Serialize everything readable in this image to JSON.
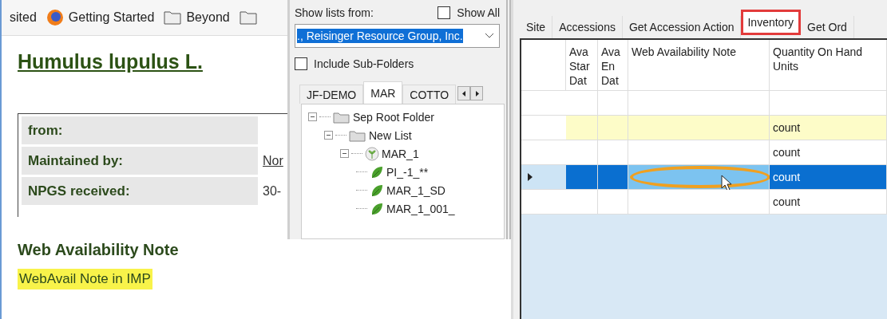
{
  "browser": {
    "bookmarks": [
      {
        "kind": "text",
        "label": "sited"
      },
      {
        "kind": "firefox",
        "label": "Getting Started"
      },
      {
        "kind": "folder",
        "label": "Beyond"
      },
      {
        "kind": "folder"
      }
    ],
    "title": "Humulus lupulus L.",
    "details": [
      {
        "label": "from:"
      },
      {
        "label": "Maintained by:",
        "value": "Nor",
        "kind": "link"
      },
      {
        "label": "NPGS received:",
        "value": "30-",
        "kind": "text"
      }
    ],
    "note_heading": "Web Availability Note",
    "note_text": "WebAvail Note in IMP"
  },
  "lists_panel": {
    "show_lists_label": "Show lists from:",
    "show_all": {
      "label": "Show All",
      "checked": false
    },
    "owner": "., Reisinger Resource Group, Inc.",
    "include_subfolders": {
      "label": "Include Sub-Folders",
      "checked": false
    },
    "tabs": [
      {
        "label": "JF-DEMO",
        "selected": false
      },
      {
        "label": "MAR",
        "selected": true
      },
      {
        "label": "COTTO",
        "selected": false
      }
    ],
    "tree": [
      {
        "label": "Sep Root Folder",
        "kind": "folder",
        "expanded": true,
        "children": [
          {
            "label": "New List",
            "kind": "folder",
            "expanded": true,
            "children": [
              {
                "label": "MAR_1",
                "kind": "accession",
                "expanded": true,
                "children": [
                  {
                    "label": "PI_-1_**",
                    "kind": "leaf"
                  },
                  {
                    "label": "MAR_1_SD",
                    "kind": "leaf"
                  },
                  {
                    "label": "MAR_1_001_",
                    "kind": "leaf"
                  }
                ]
              }
            ]
          }
        ]
      }
    ]
  },
  "grid_panel": {
    "tabs": [
      {
        "label": "Site",
        "selected": false,
        "callout": false
      },
      {
        "label": "Accessions",
        "selected": false,
        "callout": false
      },
      {
        "label": "Get Accession Action",
        "selected": false,
        "callout": false
      },
      {
        "label": "Inventory",
        "selected": true,
        "callout": true
      },
      {
        "label": "Get Ord",
        "selected": false,
        "callout": false
      }
    ],
    "columns": [
      "Ava Star Dat",
      "Ava En Dat",
      "Web Availability Note",
      "Quantity On Hand Units"
    ],
    "rows": [
      {
        "selected": false,
        "highlighted": false,
        "note_callout": false,
        "cells": [
          "",
          "",
          "",
          ""
        ]
      },
      {
        "selected": false,
        "highlighted": true,
        "note_callout": false,
        "cells": [
          "",
          "",
          "",
          "count"
        ]
      },
      {
        "selected": false,
        "highlighted": false,
        "note_callout": false,
        "cells": [
          "",
          "",
          "",
          "count"
        ]
      },
      {
        "selected": true,
        "highlighted": false,
        "note_callout": true,
        "cells": [
          "",
          "",
          "",
          "count"
        ]
      },
      {
        "selected": false,
        "highlighted": false,
        "note_callout": false,
        "cells": [
          "",
          "",
          "",
          "count"
        ]
      }
    ]
  }
}
